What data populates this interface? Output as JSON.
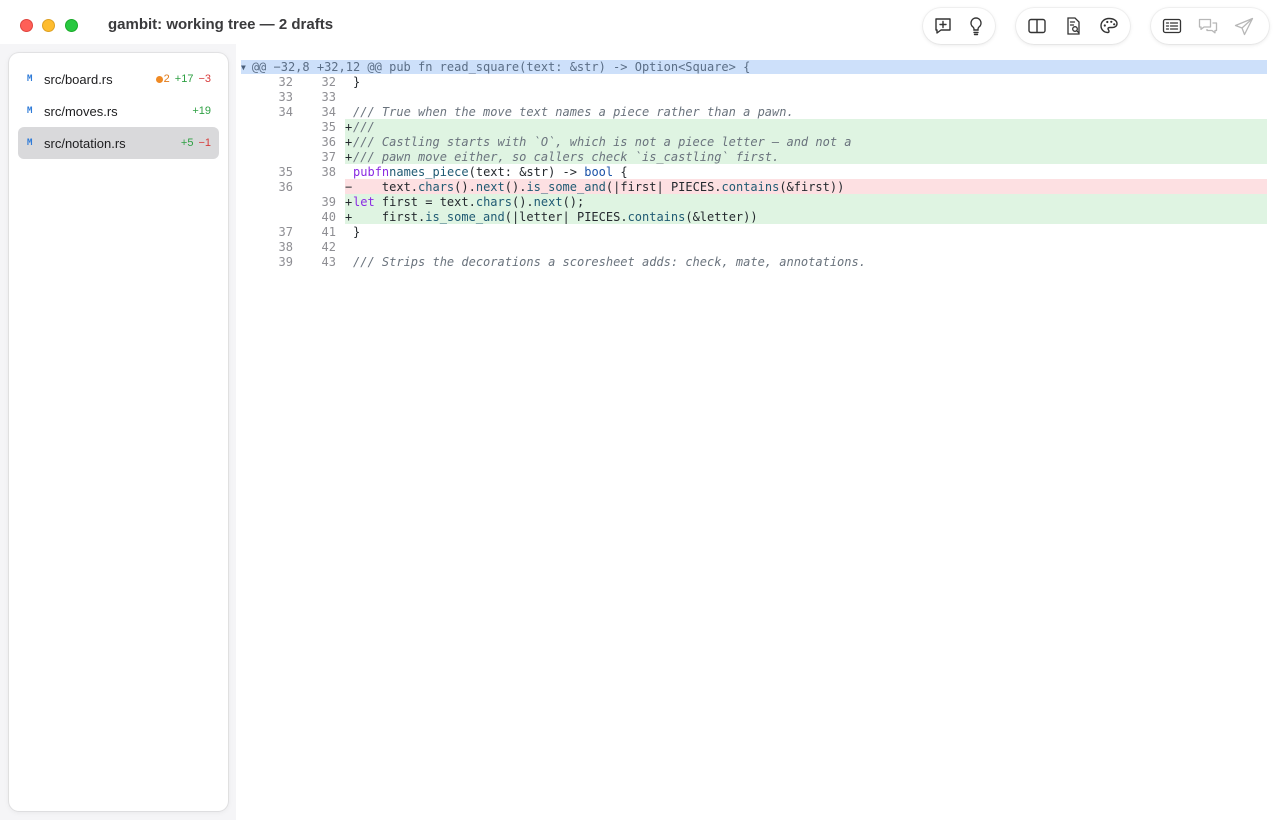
{
  "window": {
    "title": "gambit: working tree — 2 drafts"
  },
  "toolbar": {
    "groups": [
      [
        "comment-add-icon",
        "lightbulb-icon"
      ],
      [
        "split-view-icon",
        "document-search-icon",
        "palette-icon"
      ],
      [
        "list-view-icon",
        "chat-bubbles-icon",
        "send-icon"
      ]
    ]
  },
  "files": [
    {
      "status": "M",
      "name": "src/board.rs",
      "drafts": "2",
      "added": "+17",
      "removed": "−3"
    },
    {
      "status": "M",
      "name": "src/moves.rs",
      "drafts": "",
      "added": "+19",
      "removed": ""
    },
    {
      "status": "M",
      "name": "src/notation.rs",
      "drafts": "",
      "added": "+5",
      "removed": "−1",
      "selected": true
    }
  ],
  "diff": {
    "hunk": "@@ −32,8 +32,12 @@ pub fn read_square(text: &str) -> Option<Square> {",
    "lines": [
      {
        "old": "32",
        "new": "32",
        "type": "ctx",
        "code": "}"
      },
      {
        "old": "33",
        "new": "33",
        "type": "ctx",
        "code": ""
      },
      {
        "old": "34",
        "new": "34",
        "type": "ctx",
        "code": "/// True when the move text names a piece rather than a pawn."
      },
      {
        "old": "",
        "new": "35",
        "type": "add",
        "code": "///"
      },
      {
        "old": "",
        "new": "36",
        "type": "add",
        "code": "/// Castling starts with `O`, which is not a piece letter — and not a"
      },
      {
        "old": "",
        "new": "37",
        "type": "add",
        "code": "/// pawn move either, so callers check `is_castling` first."
      },
      {
        "old": "35",
        "new": "38",
        "type": "ctx",
        "code": "pub fn names_piece(text: &str) -> bool {"
      },
      {
        "old": "36",
        "new": "",
        "type": "del",
        "code": "    text.chars().next().is_some_and(|first| PIECES.contains(&first))"
      },
      {
        "old": "",
        "new": "39",
        "type": "add",
        "code": "    let first = text.chars().next();"
      },
      {
        "old": "",
        "new": "40",
        "type": "add",
        "code": "    first.is_some_and(|letter| PIECES.contains(&letter))"
      },
      {
        "old": "37",
        "new": "41",
        "type": "ctx",
        "code": "}"
      },
      {
        "old": "38",
        "new": "42",
        "type": "ctx",
        "code": ""
      },
      {
        "old": "39",
        "new": "43",
        "type": "ctx",
        "code": "/// Strips the decorations a scoresheet adds: check, mate, annotations."
      }
    ]
  }
}
